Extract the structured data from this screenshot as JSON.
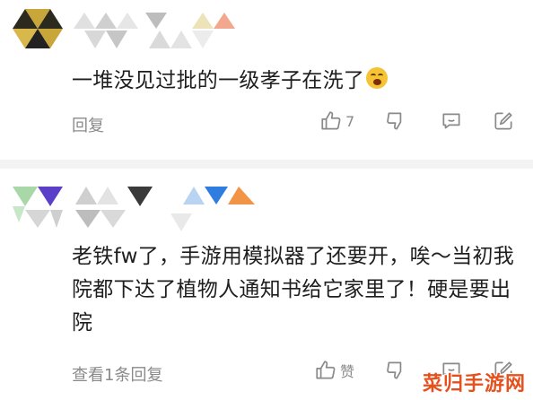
{
  "comments": [
    {
      "text": "一堆没见过批的一级孝子在洗了",
      "reply_label": "回复",
      "like_count": "7"
    },
    {
      "text": "老铁fw了，手游用模拟器了还要开，唉～当初我院都下达了植物人通知书给它家里了！硬是要出院",
      "reply_label": "查看1条回复",
      "like_label": "赞"
    }
  ],
  "watermark": "菜归手游网",
  "colors": {
    "text": "#1e1e1e",
    "muted": "#8a8a8a",
    "divider": "#f3f3f3",
    "watermark": "#e7501c"
  },
  "icons": [
    "thumbs-up-icon",
    "thumbs-down-icon",
    "chat-bubble-icon",
    "share-icon"
  ]
}
